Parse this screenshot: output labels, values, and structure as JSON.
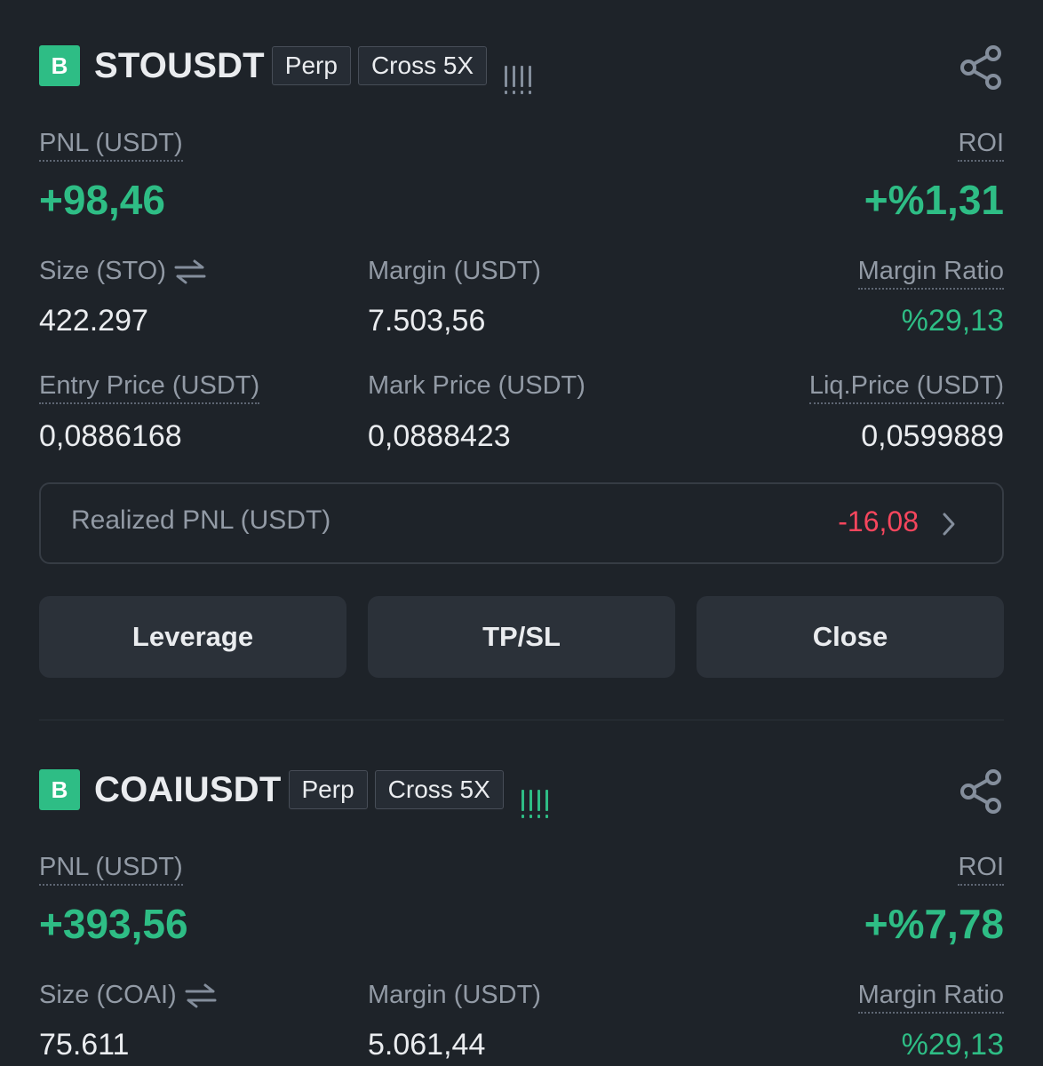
{
  "positions": [
    {
      "badge": "B",
      "symbol": "STOUSDT",
      "type_tag": "Perp",
      "margin_tag": "Cross 5X",
      "bars_color": "#848e9c",
      "pnl_label": "PNL (USDT)",
      "pnl_value": "+98,46",
      "roi_label": "ROI",
      "roi_value": "+%1,31",
      "size_label": "Size (STO)",
      "size_value": "422.297",
      "margin_label": "Margin (USDT)",
      "margin_value": "7.503,56",
      "margin_ratio_label": "Margin Ratio",
      "margin_ratio_value": "%29,13",
      "entry_label": "Entry Price (USDT)",
      "entry_value": "0,0886168",
      "mark_label": "Mark Price (USDT)",
      "mark_value": "0,0888423",
      "liq_label": "Liq.Price (USDT)",
      "liq_value": "0,0599889",
      "realized_label": "Realized PNL (USDT)",
      "realized_value": "-16,08",
      "buttons": [
        "Leverage",
        "TP/SL",
        "Close"
      ]
    },
    {
      "badge": "B",
      "symbol": "COAIUSDT",
      "type_tag": "Perp",
      "margin_tag": "Cross 5X",
      "bars_color": "#2ebd85",
      "pnl_label": "PNL (USDT)",
      "pnl_value": "+393,56",
      "roi_label": "ROI",
      "roi_value": "+%7,78",
      "size_label": "Size (COAI)",
      "size_value": "75.611",
      "margin_label": "Margin (USDT)",
      "margin_value": "5.061,44",
      "margin_ratio_label": "Margin Ratio",
      "margin_ratio_value": "%29,13"
    }
  ],
  "icons": {
    "share": "share-icon",
    "swap": "swap-arrows-icon",
    "chevron": "chevron-right-icon"
  },
  "colors": {
    "background": "#1e2329",
    "profit": "#2ebd85",
    "loss": "#f6465d",
    "button": "#2b3139"
  }
}
